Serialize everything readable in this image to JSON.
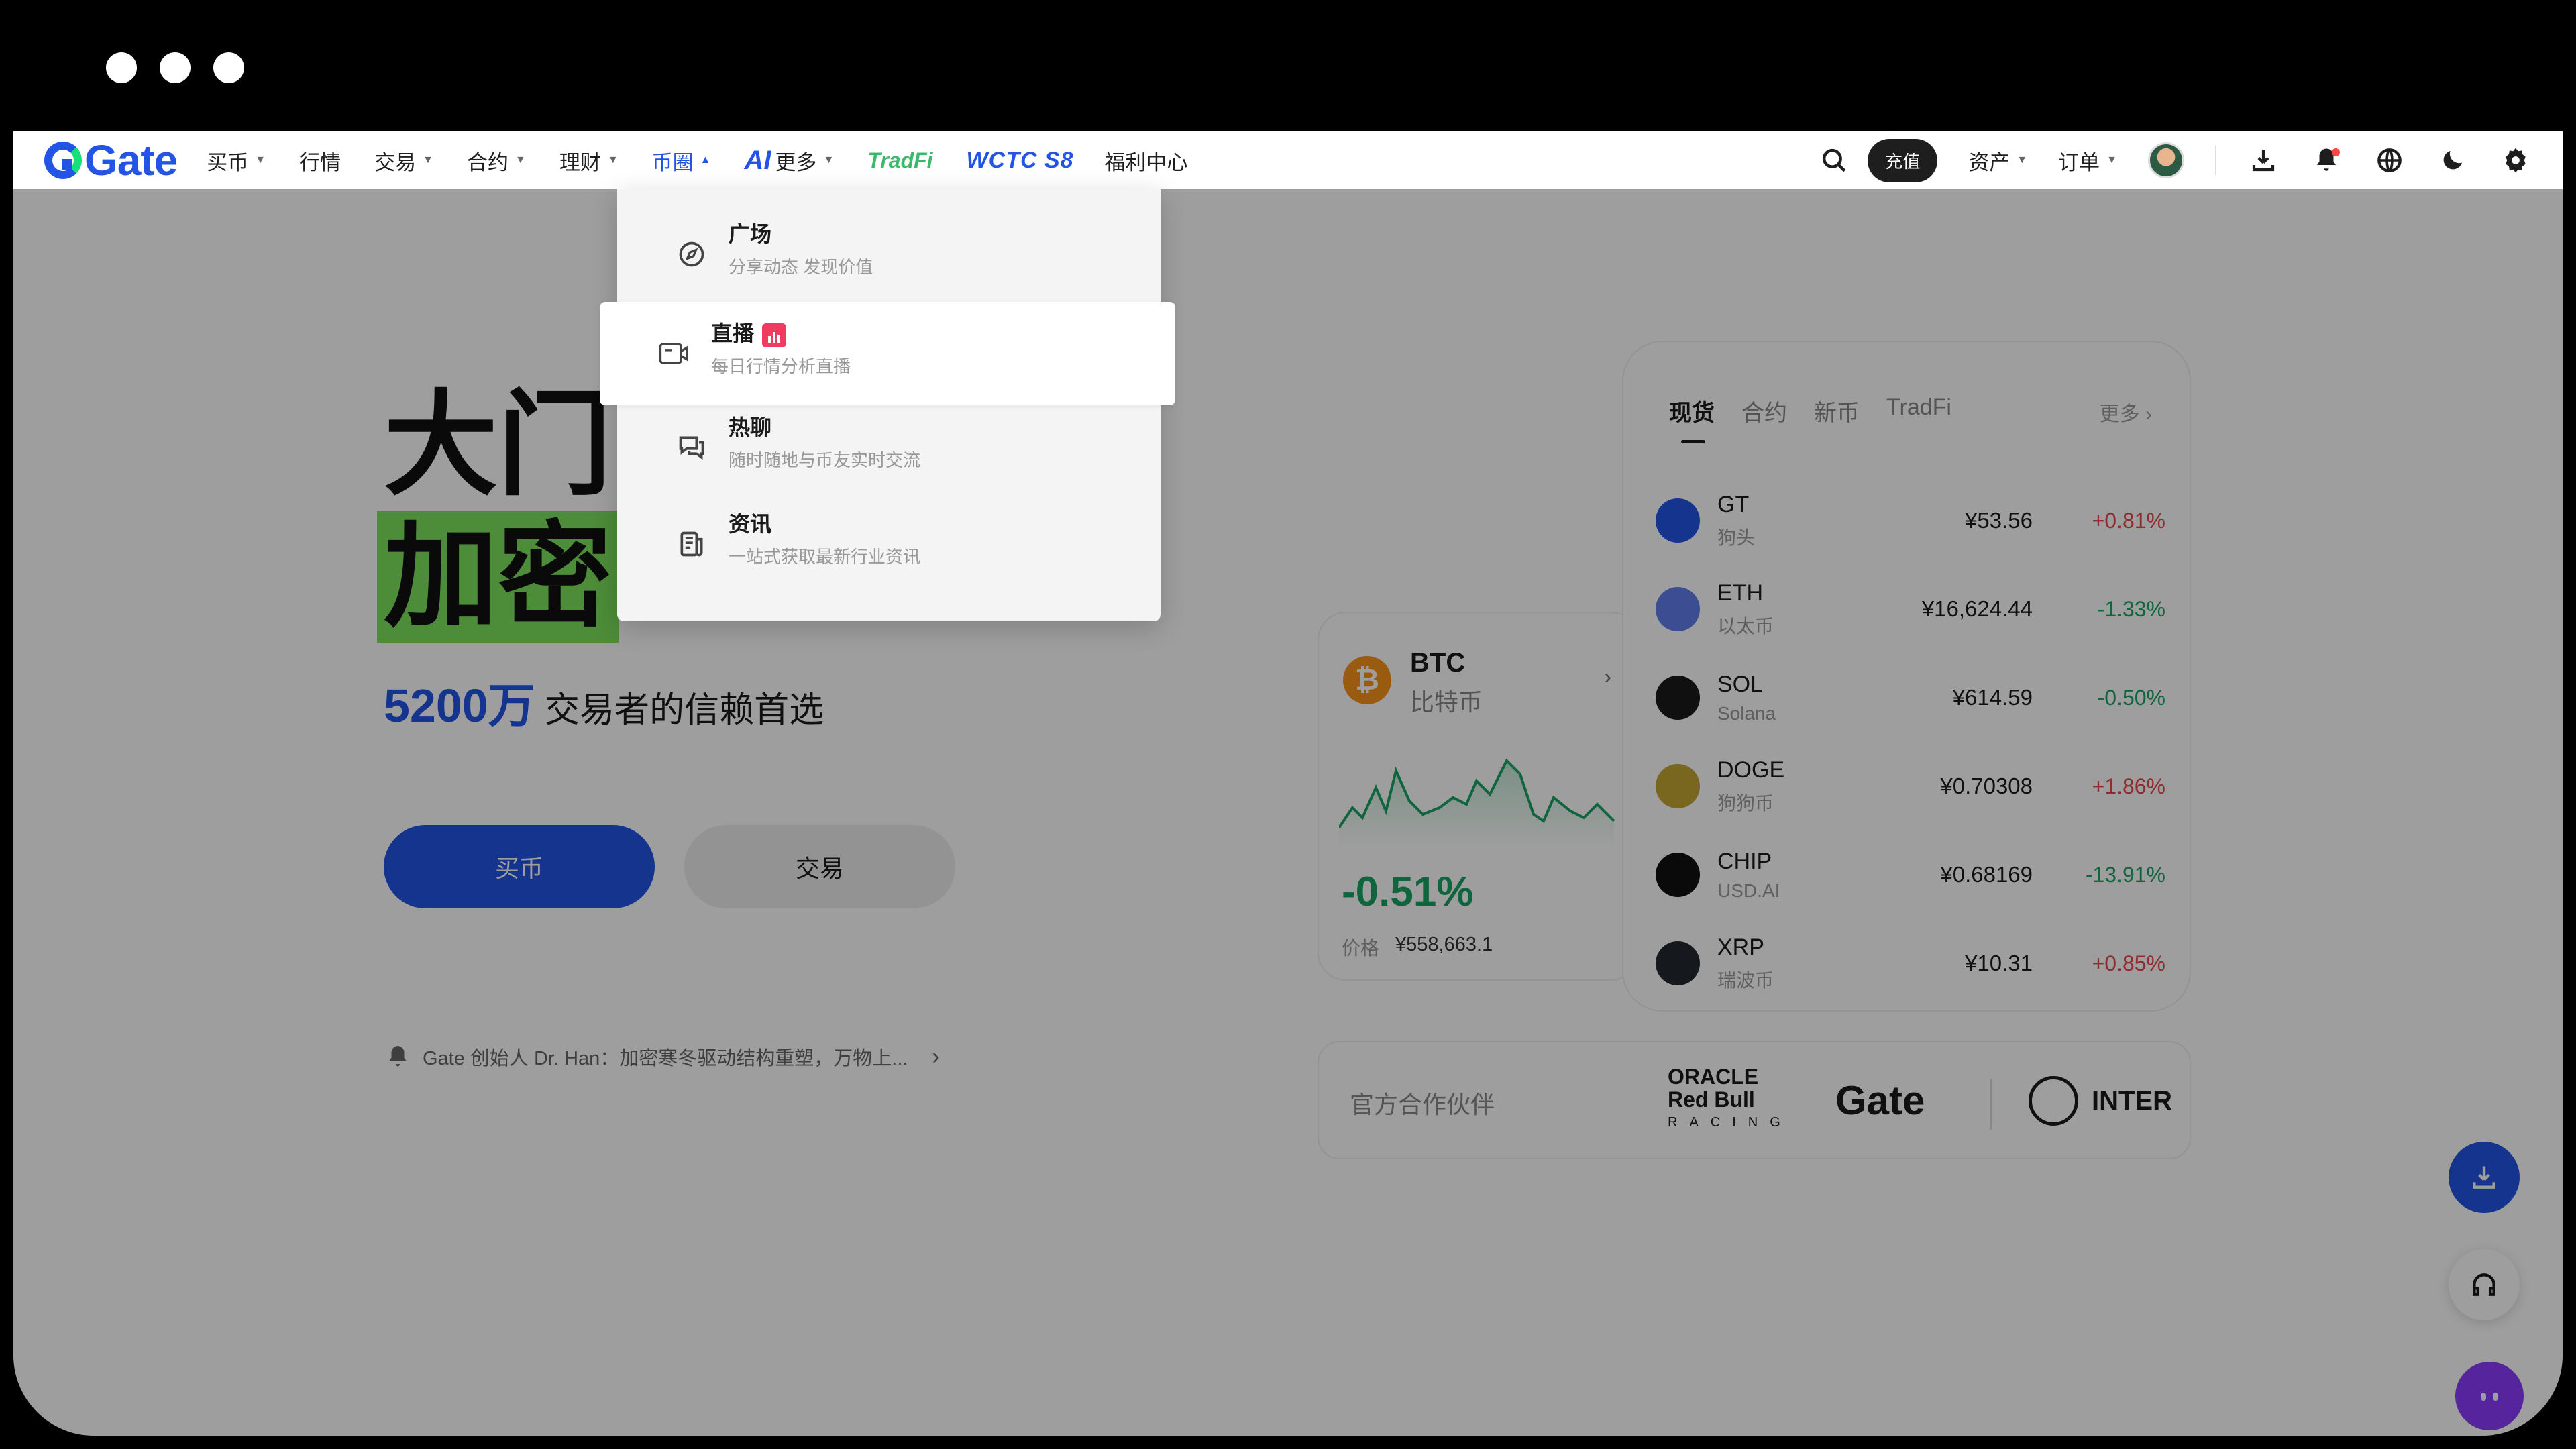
{
  "nav": {
    "logo": "Gate",
    "items": [
      {
        "label": "买币",
        "caret": true
      },
      {
        "label": "行情",
        "caret": false
      },
      {
        "label": "交易",
        "caret": true
      },
      {
        "label": "合约",
        "caret": true
      },
      {
        "label": "理财",
        "caret": true
      },
      {
        "label": "币圈",
        "caret": true,
        "active": true
      }
    ],
    "ai_label": "AI",
    "more_label": "更多",
    "tradfi": "TradFi",
    "wctc": "WCTC S8",
    "welfare": "福利中心",
    "deposit": "充值",
    "assets": "资产",
    "orders": "订单",
    "icons": [
      "search-icon",
      "download-icon",
      "bell-icon",
      "globe-icon",
      "moon-icon",
      "settings-icon"
    ]
  },
  "dropdown": {
    "items": [
      {
        "title": "广场",
        "desc": "分享动态 发现价值",
        "icon": "compass-icon"
      },
      {
        "title": "直播",
        "desc": "每日行情分析直播",
        "icon": "live-video-icon",
        "highlight": true
      },
      {
        "title": "热聊",
        "desc": "随时随地与币友实时交流",
        "icon": "chat-icon"
      },
      {
        "title": "资讯",
        "desc": "一站式获取最新行业资讯",
        "icon": "news-icon"
      }
    ]
  },
  "hero": {
    "line1": "大门",
    "line2": "加密",
    "sub_number": "5200万",
    "sub_text": " 交易者的信赖首选",
    "buy_label": "买币",
    "trade_label": "交易",
    "notice": "Gate 创始人 Dr. Han：加密寒冬驱动结构重塑，万物上..."
  },
  "market": {
    "tabs": [
      "现货",
      "合约",
      "新币",
      "TradFi"
    ],
    "more": "更多",
    "rows": [
      {
        "sym": "GT",
        "name": "狗头",
        "price": "¥53.56",
        "change": "+0.81%",
        "dir": "up",
        "color": "#2354e6"
      },
      {
        "sym": "ETH",
        "name": "以太币",
        "price": "¥16,624.44",
        "change": "-1.33%",
        "dir": "down",
        "color": "#627eea"
      },
      {
        "sym": "SOL",
        "name": "Solana",
        "price": "¥614.59",
        "change": "-0.50%",
        "dir": "down",
        "color": "#1a1a1a"
      },
      {
        "sym": "DOGE",
        "name": "狗狗币",
        "price": "¥0.70308",
        "change": "+1.86%",
        "dir": "up",
        "color": "#c3a634"
      },
      {
        "sym": "CHIP",
        "name": "USD.AI",
        "price": "¥0.68169",
        "change": "-13.91%",
        "dir": "down",
        "color": "#111111"
      },
      {
        "sym": "XRP",
        "name": "瑞波币",
        "price": "¥10.31",
        "change": "+0.85%",
        "dir": "up",
        "color": "#23292f"
      }
    ]
  },
  "btc": {
    "sym": "BTC",
    "name": "比特币",
    "change": "-0.51%",
    "price_label": "价格",
    "price": "¥558,663.1"
  },
  "partners": {
    "label": "官方合作伙伴",
    "oracle_line1": "ORACLE",
    "oracle_line2": "Red Bull",
    "oracle_line3": "RACING",
    "gate": "Gate",
    "inter": "INTER"
  }
}
